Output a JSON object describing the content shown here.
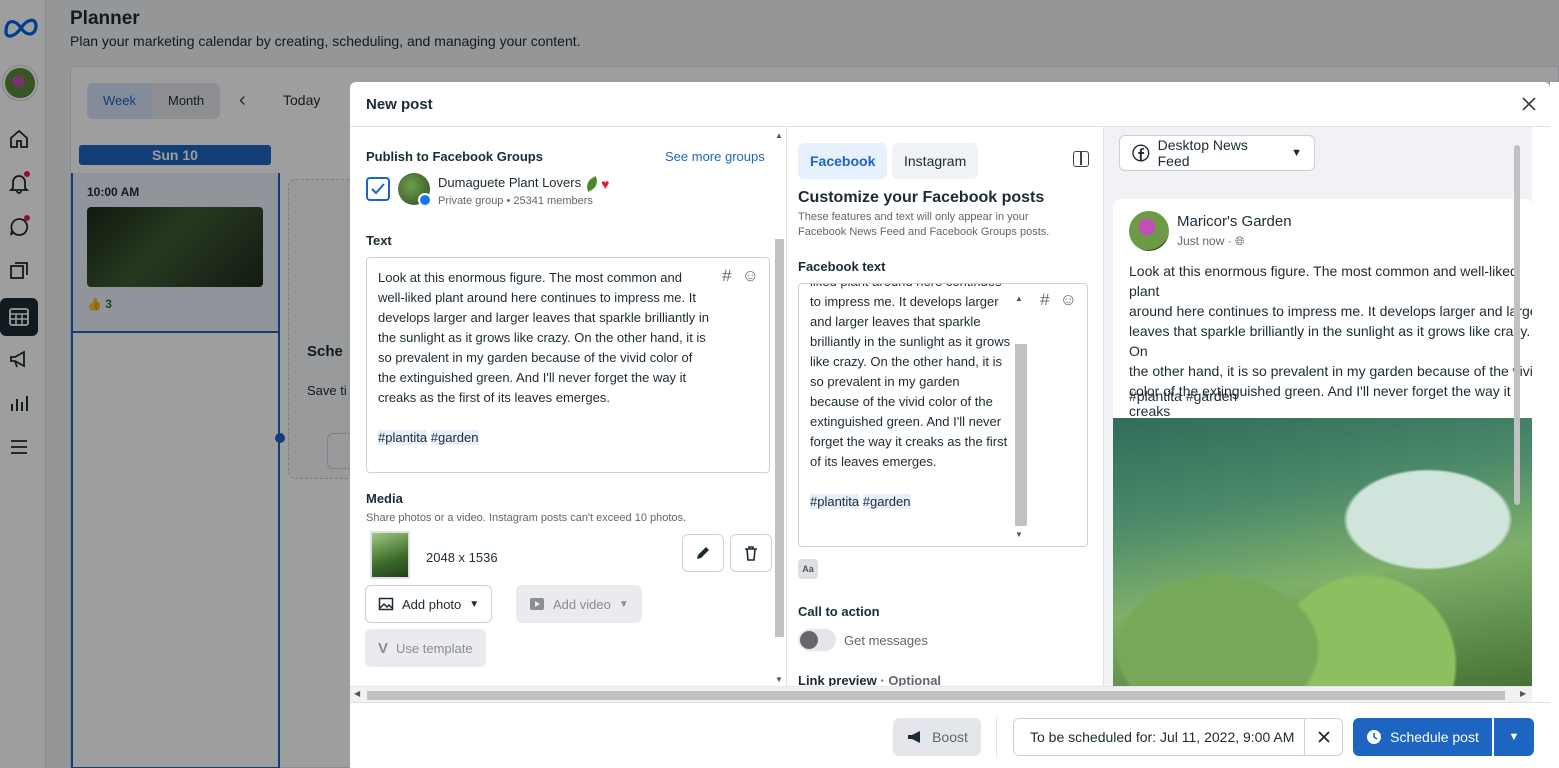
{
  "app": {
    "title": "Planner",
    "subtitle": "Plan your marketing calendar by creating, scheduling, and managing your content."
  },
  "calendar": {
    "view_week": "Week",
    "view_month": "Month",
    "today_label": "Today",
    "day_header": "Sun 10",
    "event_time": "10:00 AM",
    "event_likes": "3",
    "ghost_title": "Sche",
    "ghost_sub": "Save ti",
    "ghost_btn": "S"
  },
  "modal": {
    "title": "New post",
    "left": {
      "publish_label": "Publish to Facebook Groups",
      "see_more": "See more groups",
      "group_name": "Dumaguete Plant Lovers",
      "group_meta": "Private group • 25341 members",
      "group_checked": true,
      "text_label": "Text",
      "post_text": "Look at this enormous figure. The most common and well-liked plant around here continues to impress me. It develops larger and larger leaves that sparkle brilliantly in the sunlight as it grows like crazy. On the other hand, it is so prevalent in my garden because of the vivid color of the extinguished green. And I'll never forget the way it creaks as the first of its leaves emerges.",
      "tag1": "#plantita",
      "tag2": "#garden",
      "media_label": "Media",
      "media_sub": "Share photos or a video. Instagram posts can't exceed 10 photos.",
      "media_size": "2048 x 1536",
      "add_photo": "Add photo",
      "add_video": "Add video",
      "use_template": "Use template"
    },
    "middle": {
      "tab_facebook": "Facebook",
      "tab_instagram": "Instagram",
      "customize_title": "Customize your Facebook posts",
      "customize_sub": "These features and text will only appear in your Facebook News Feed and Facebook Groups posts.",
      "fb_text_label": "Facebook text",
      "fb_text": "liked plant around here continues to impress me. It develops larger and larger leaves that sparkle brilliantly in the sunlight as it grows like crazy. On the other hand, it is so prevalent in my garden because of the vivid color of the extinguished green. And I'll never forget the way it creaks as the first of its leaves emerges.",
      "aa_icon": "Aa",
      "cta_label": "Call to action",
      "cta_option": "Get messages",
      "cta_enabled": false,
      "link_preview_label": "Link preview",
      "link_preview_optional": "· Optional"
    },
    "preview": {
      "placement": "Desktop News Feed",
      "page_name": "Maricor's Garden",
      "time": "Just now ·",
      "text": "Look at this enormous figure. The most common and well-liked plant\naround here continues to impress me. It develops larger and larger\nleaves that sparkle brilliantly in the sunlight as it grows like crazy. On\nthe other hand, it is so prevalent in my garden because of the vivid\ncolor of the extinguished green. And I'll never forget the way it creaks\nas the first of its leaves emerges.",
      "tags": "#plantita #garden"
    },
    "footer": {
      "boost": "Boost",
      "scheduled_prefix": "To be scheduled for: ",
      "scheduled_date": "Jul 11, 2022, 9:00 AM",
      "schedule_button": "Schedule post"
    }
  },
  "colors": {
    "accent": "#1d65c1",
    "tag_bg": "#e7f0fd"
  }
}
